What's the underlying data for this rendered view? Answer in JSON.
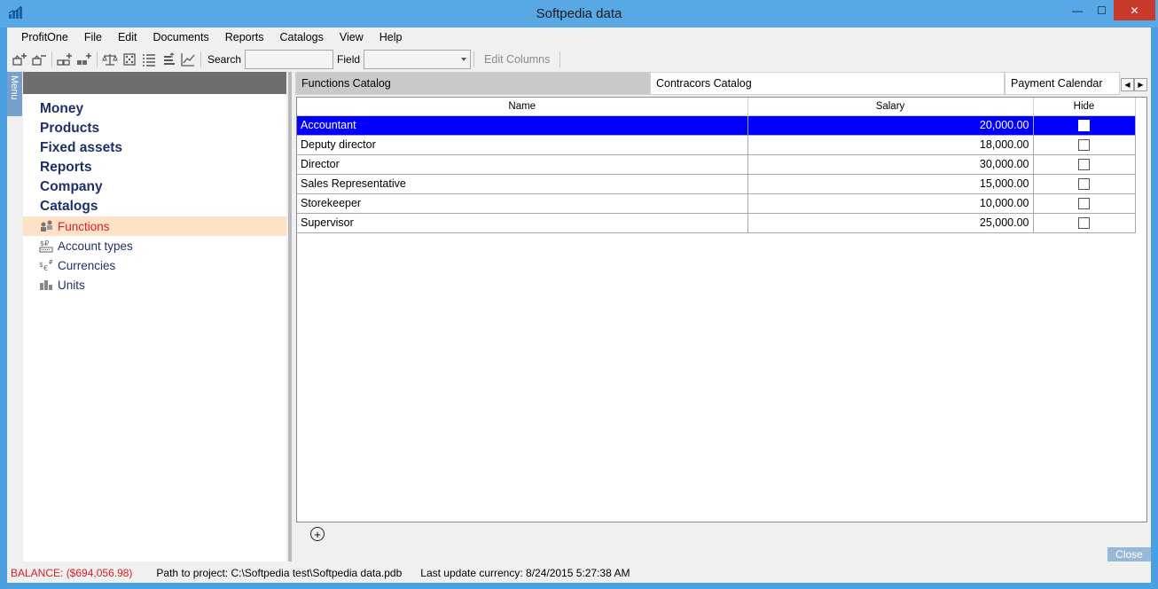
{
  "window": {
    "title": "Softpedia data",
    "controls": {
      "minimize": "—",
      "maximize": "☐",
      "close": "✕"
    }
  },
  "menubar": [
    "ProfitOne",
    "File",
    "Edit",
    "Documents",
    "Reports",
    "Catalogs",
    "View",
    "Help"
  ],
  "toolbar": {
    "search_label": "Search",
    "search_value": "",
    "field_label": "Field",
    "field_value": "",
    "edit_columns_label": "Edit Columns"
  },
  "sidebar": {
    "strip_label": "Menu",
    "sections": [
      "Money",
      "Products",
      "Fixed assets",
      "Reports",
      "Company",
      "Catalogs"
    ],
    "catalog_items": [
      {
        "label": "Functions",
        "icon": "functions-icon",
        "active": true
      },
      {
        "label": "Account types",
        "icon": "account-types-icon",
        "active": false
      },
      {
        "label": "Currencies",
        "icon": "currencies-icon",
        "active": false
      },
      {
        "label": "Units",
        "icon": "units-icon",
        "active": false
      }
    ]
  },
  "tabs": [
    {
      "label": "Functions Catalog",
      "active": true
    },
    {
      "label": "Contracors Catalog",
      "active": false
    },
    {
      "label": "Payment Calendar",
      "active": false
    }
  ],
  "grid": {
    "columns": [
      "Name",
      "Salary",
      "Hide"
    ],
    "rows": [
      {
        "name": "Accountant",
        "salary": "20,000.00",
        "hide": false,
        "selected": true
      },
      {
        "name": "Deputy director",
        "salary": "18,000.00",
        "hide": false,
        "selected": false
      },
      {
        "name": "Director",
        "salary": "30,000.00",
        "hide": false,
        "selected": false
      },
      {
        "name": "Sales Representative",
        "salary": "15,000.00",
        "hide": false,
        "selected": false
      },
      {
        "name": "Storekeeper",
        "salary": "10,000.00",
        "hide": false,
        "selected": false
      },
      {
        "name": "Supervisor",
        "salary": "25,000.00",
        "hide": false,
        "selected": false
      }
    ]
  },
  "close_label": "Close",
  "status": {
    "balance": "BALANCE: ($694,056.98)",
    "path": "Path to project: C:\\Softpedia test\\Softpedia data.pdb",
    "last_update": "Last update currency: 8/24/2015 5:27:38 AM"
  }
}
